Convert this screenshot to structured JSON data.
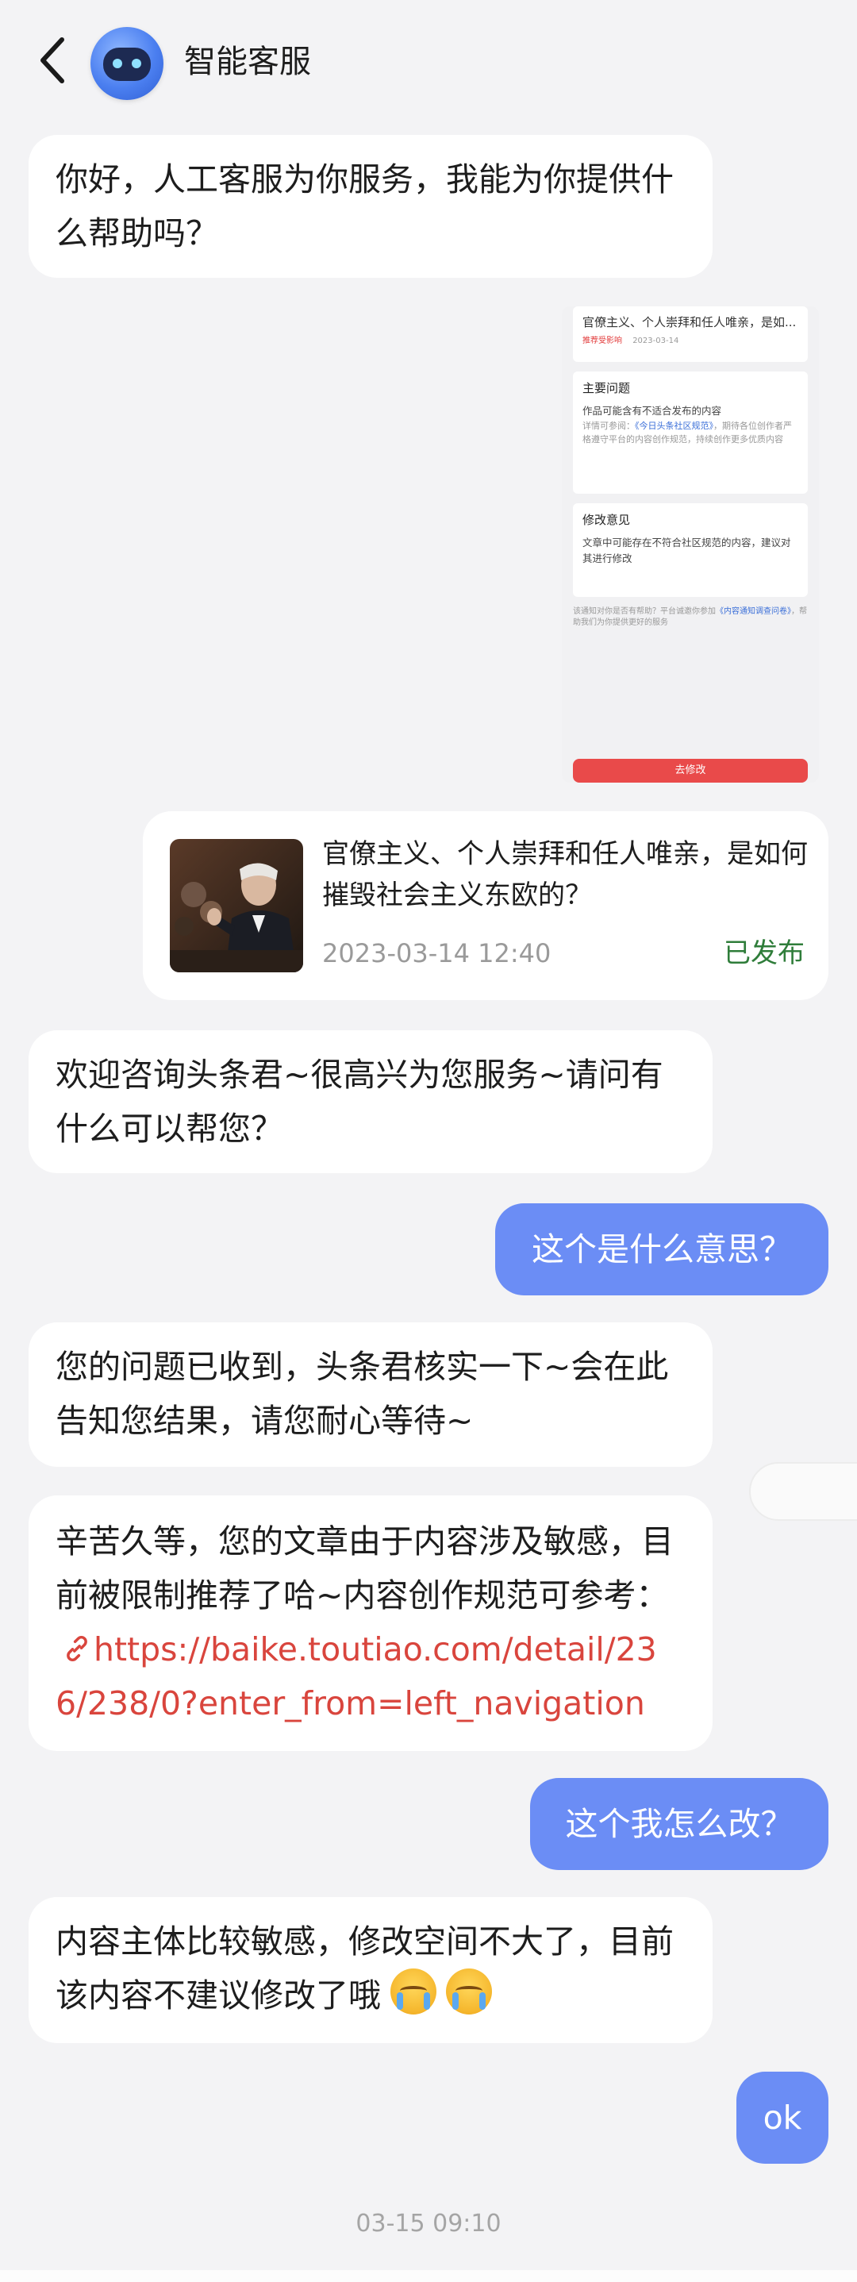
{
  "header": {
    "title": "智能客服"
  },
  "preview": {
    "card1_title": "官僚主义、个人崇拜和任人唯亲，是如...",
    "card1_tag": "推荐受影响",
    "card1_date": "2023-03-14",
    "card2_heading": "主要问题",
    "card2_problem": "作品可能含有不适合发布的内容",
    "card2_detail_prefix": "详情可参阅：",
    "card2_link": "《今日头条社区规范》",
    "card2_detail_suffix": "，期待各位创作者严格遵守平台的内容创作规范，持续创作更多优质内容",
    "card3_heading": "修改意见",
    "card3_body": "文章中可能存在不符合社区规范的内容，建议对其进行修改",
    "feedback_prefix": "该通知对你是否有帮助？平台诚邀你参加",
    "feedback_link": "《内容通知调查问卷》",
    "feedback_suffix": "，帮助我们为你提供更好的服务",
    "button_label": "去修改"
  },
  "article": {
    "title": "官僚主义、个人崇拜和任人唯亲，是如何摧毁社会主义东欧的？",
    "date": "2023-03-14 12:40",
    "status": "已发布"
  },
  "messages": {
    "m1": "你好，人工客服为你服务，我能为你提供什么帮助吗？",
    "m2": "欢迎咨询头条君~很高兴为您服务~请问有什么可以帮您？",
    "u1": "这个是什么意思？",
    "m3": "您的问题已收到，头条君核实一下~会在此告知您结果，请您耐心等待~",
    "m4_text": "辛苦久等，您的文章由于内容涉及敏感，目前被限制推荐了哈~内容创作规范可参考：",
    "m4_link": "https://baike.toutiao.com/detail/236/238/0?enter_from=left_navigation",
    "u2": "这个我怎么改？",
    "m5": "内容主体比较敏感，修改空间不大了，目前该内容不建议修改了哦",
    "u3": "ok"
  },
  "timestamp": "03-15 09:10",
  "icons": {
    "back": "chevron-left-icon",
    "link": "link-icon",
    "emoji": "loudly-crying-face-emoji"
  },
  "colors": {
    "background": "#f3f3f5",
    "user_bubble": "#6b8df5",
    "link": "#d9453d",
    "published": "#2f7d3a",
    "modify_button": "#e94a4a"
  }
}
